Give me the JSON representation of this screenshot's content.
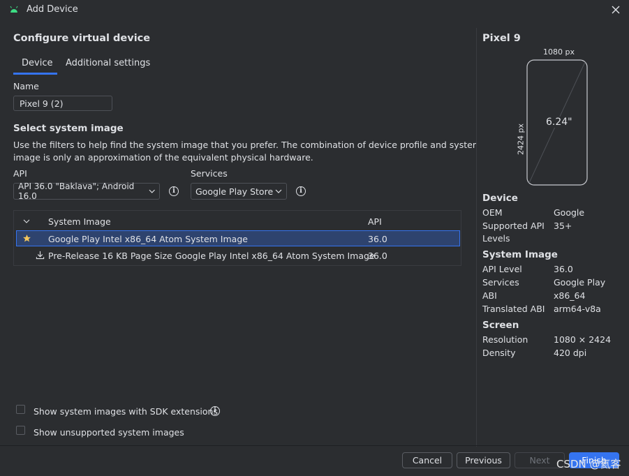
{
  "window": {
    "title": "Add Device"
  },
  "main": {
    "heading": "Configure virtual device",
    "tabs": [
      {
        "label": "Device"
      },
      {
        "label": "Additional settings"
      }
    ],
    "name_label": "Name",
    "name_value": "Pixel 9 (2)",
    "system_image_heading": "Select system image",
    "description_line1": "Use the filters to help find the system image that you prefer. The combination of device profile and system",
    "description_line2": "image is only an approximation of the equivalent physical hardware.",
    "api_label": "API",
    "api_value": "API 36.0 \"Baklava\"; Android 16.0",
    "services_label": "Services",
    "services_value": "Google Play Store",
    "table": {
      "columns": [
        "System Image",
        "API"
      ],
      "rows": [
        {
          "name": "Google Play Intel x86_64 Atom System Image",
          "api": "36.0",
          "icon": "star-icon"
        },
        {
          "name": "Pre-Release 16 KB Page Size Google Play Intel x86_64 Atom System Image",
          "api": "36.0",
          "icon": "download-icon"
        }
      ]
    },
    "sdk_extensions_label": "Show system images with SDK extensions",
    "unsupported_label": "Show unsupported system images"
  },
  "preview": {
    "device_name": "Pixel 9",
    "width_label": "1080 px",
    "height_label": "2424 px",
    "diagonal": "6.24\"",
    "device_section": "Device",
    "oem_key": "OEM",
    "oem_value": "Google",
    "supported_api_key1": "Supported API",
    "supported_api_key2": "Levels",
    "supported_api_value": "35+",
    "system_image_section": "System Image",
    "api_level_key": "API Level",
    "api_level_value": "36.0",
    "services_key": "Services",
    "services_value": "Google Play",
    "abi_key": "ABI",
    "abi_value": "x86_64",
    "translated_abi_key": "Translated ABI",
    "translated_abi_value": "arm64-v8a",
    "screen_section": "Screen",
    "resolution_key": "Resolution",
    "resolution_value": "1080 × 2424",
    "density_key": "Density",
    "density_value": "420 dpi"
  },
  "footer": {
    "cancel": "Cancel",
    "previous": "Previous",
    "next": "Next",
    "finish": "Finish"
  },
  "watermark": "CSDN @氦客",
  "colors": {
    "accent": "#3574f0",
    "background": "#2b2d30",
    "selected_row": "#2e436e",
    "star": "#f2c55c"
  }
}
